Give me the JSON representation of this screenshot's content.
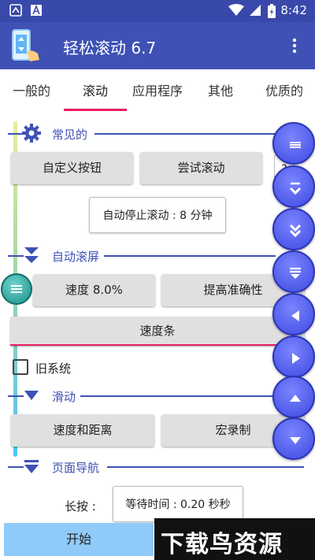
{
  "status_bar": {
    "time": "8:42"
  },
  "app": {
    "title": "轻松滚动 6.7"
  },
  "tabs": [
    "一般的",
    "滚动",
    "应用程序",
    "其他",
    "优质的"
  ],
  "sections": {
    "common": {
      "title": "常见的",
      "custom_button": "自定义按钮",
      "try_scroll": "尝试滚动",
      "help": "?",
      "auto_stop": "自动停止滚动 : 8 分钟"
    },
    "auto_scroll": {
      "title": "自动滚屏",
      "speed": "速度 8.0%",
      "improve_accuracy": "提高准确性",
      "speed_bar": "速度条",
      "old_system": "旧系统"
    },
    "slide": {
      "title": "滑动",
      "speed_distance": "速度和距离",
      "macro_record": "宏录制"
    },
    "page_nav": {
      "title": "页面导航",
      "long_press_label": "长按 :",
      "wait_time": "等待时间 : 0.20 秒秒"
    }
  },
  "start_button": "开始",
  "watermark": "下载鸟资源",
  "colors": {
    "primary": "#3f51b5",
    "status": "#3949ab",
    "accent": "#e91e63",
    "fab": "#4a56f0",
    "start": "#90caf9"
  }
}
